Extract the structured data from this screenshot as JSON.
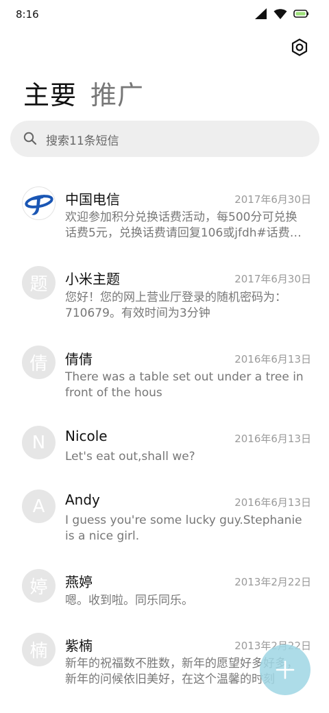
{
  "status_bar": {
    "time": "8:16",
    "icons": [
      "signal-icon",
      "wifi-icon",
      "battery-icon"
    ]
  },
  "header": {
    "settings_icon": "settings-icon",
    "tabs": [
      {
        "label": "主要",
        "active": true
      },
      {
        "label": "推广",
        "active": false
      }
    ]
  },
  "search": {
    "placeholder": "搜索11条短信",
    "icon": "search-icon"
  },
  "conversations": [
    {
      "name": "中国电信",
      "date": "2017年6月30日",
      "avatar": "china-telecom-logo",
      "preview": "欢迎参加积分兑换话费活动，每500分可兑换话费5元，兑换话费请回复106或jfdh#话费…"
    },
    {
      "name": "小米主题",
      "date": "2017年6月30日",
      "avatar": "题",
      "preview": "您好！您的网上营业厅登录的随机密码为：710679。有效时间为3分钟"
    },
    {
      "name": "倩倩",
      "date": "2016年6月13日",
      "avatar": "倩",
      "preview": "There was a table set out under a tree in front of the hous"
    },
    {
      "name": "Nicole",
      "date": "2016年6月13日",
      "avatar": "N",
      "preview": "Let's eat out,shall we?"
    },
    {
      "name": "Andy",
      "date": "2016年6月13日",
      "avatar": "A",
      "preview": "I guess you're some lucky guy.Stephanie is a nice girl."
    },
    {
      "name": "燕婷",
      "date": "2013年2月22日",
      "avatar": "婷",
      "preview": "嗯。收到啦。同乐同乐。"
    },
    {
      "name": "紫楠",
      "date": "2013年2月22日",
      "avatar": "楠",
      "preview": "新年的祝福数不胜数，新年的愿望好多好多，新年的问候依旧美好，在这个温馨的时刻"
    }
  ],
  "fab": {
    "icon": "plus-icon"
  },
  "colors": {
    "accent": "#A0D6E4",
    "telecom_blue": "#1A56B4",
    "avatar_bg": "#E6E6E6"
  }
}
